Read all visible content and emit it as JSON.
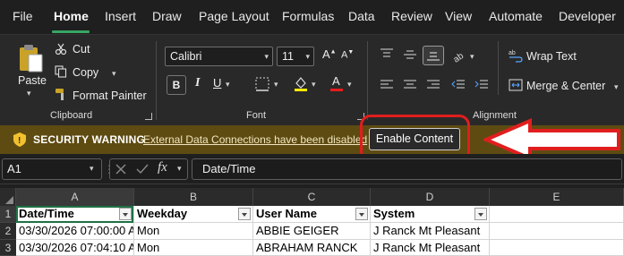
{
  "menu": {
    "tabs": [
      "File",
      "Home",
      "Insert",
      "Draw",
      "Page Layout",
      "Formulas",
      "Data",
      "Review",
      "View",
      "Automate",
      "Developer"
    ],
    "active": "Home"
  },
  "ribbon": {
    "clipboard": {
      "paste_label": "Paste",
      "cut_label": "Cut",
      "copy_label": "Copy",
      "format_painter_label": "Format Painter",
      "group_label": "Clipboard"
    },
    "font": {
      "font_name": "Calibri",
      "font_size": "11",
      "bold": "B",
      "group_label": "Font"
    },
    "alignment": {
      "wrap_text_label": "Wrap Text",
      "merge_center_label": "Merge & Center",
      "group_label": "Alignment"
    }
  },
  "security_bar": {
    "title": "SECURITY WARNING",
    "message": "External Data Connections have been disabled",
    "button_label": "Enable Content"
  },
  "formula_bar": {
    "name_box": "A1",
    "fx_label": "fx",
    "formula": "Date/Time"
  },
  "sheet": {
    "columns": [
      "A",
      "B",
      "C",
      "D",
      "E"
    ],
    "rows": [
      "1",
      "2",
      "3"
    ],
    "cells": [
      [
        "Date/Time",
        "Weekday",
        "User Name",
        "System"
      ],
      [
        "03/30/2026 07:00:00 A",
        "Mon",
        "ABBIE GEIGER",
        "J Ranck Mt Pleasant"
      ],
      [
        "03/30/2026 07:04:10 A",
        "Mon",
        "ABRAHAM RANCK",
        "J Ranck Mt Pleasant"
      ]
    ]
  },
  "colors": {
    "warning_bar": "#5e4b12",
    "annotation_red": "#e01e1e",
    "active_tab_underline": "#37a664",
    "selection": "#1e7145"
  }
}
